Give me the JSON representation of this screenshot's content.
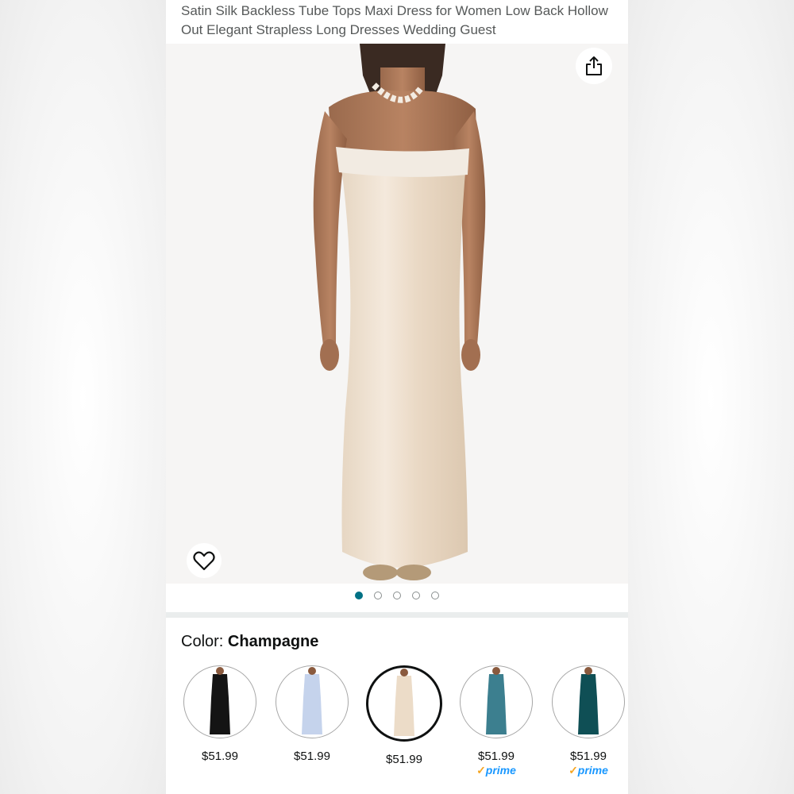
{
  "product": {
    "title": "Satin Silk Backless Tube Tops Maxi Dress for Women Low Back Hollow Out Elegant Strapless Long Dresses Wedding Guest"
  },
  "gallery": {
    "image_count": 5,
    "active_index": 0,
    "share_icon": "share-icon",
    "favorite_icon": "heart-icon"
  },
  "color": {
    "label": "Color: ",
    "selected": "Champagne"
  },
  "variants": [
    {
      "price": "$51.99",
      "prime": "",
      "color": "#141414"
    },
    {
      "price": "$51.99",
      "prime": "",
      "color": "#c5d3ec"
    },
    {
      "price": "$51.99",
      "prime": "",
      "color": "#ecdcc8"
    },
    {
      "price": "$51.99",
      "prime": "prime",
      "color": "#3c7f8f"
    },
    {
      "price": "$51.99",
      "prime": "prime",
      "color": "#0f4f55"
    }
  ],
  "colors": {
    "accent_teal": "#007185",
    "prime_blue": "#1a98ff",
    "prime_check": "#f5a623"
  }
}
